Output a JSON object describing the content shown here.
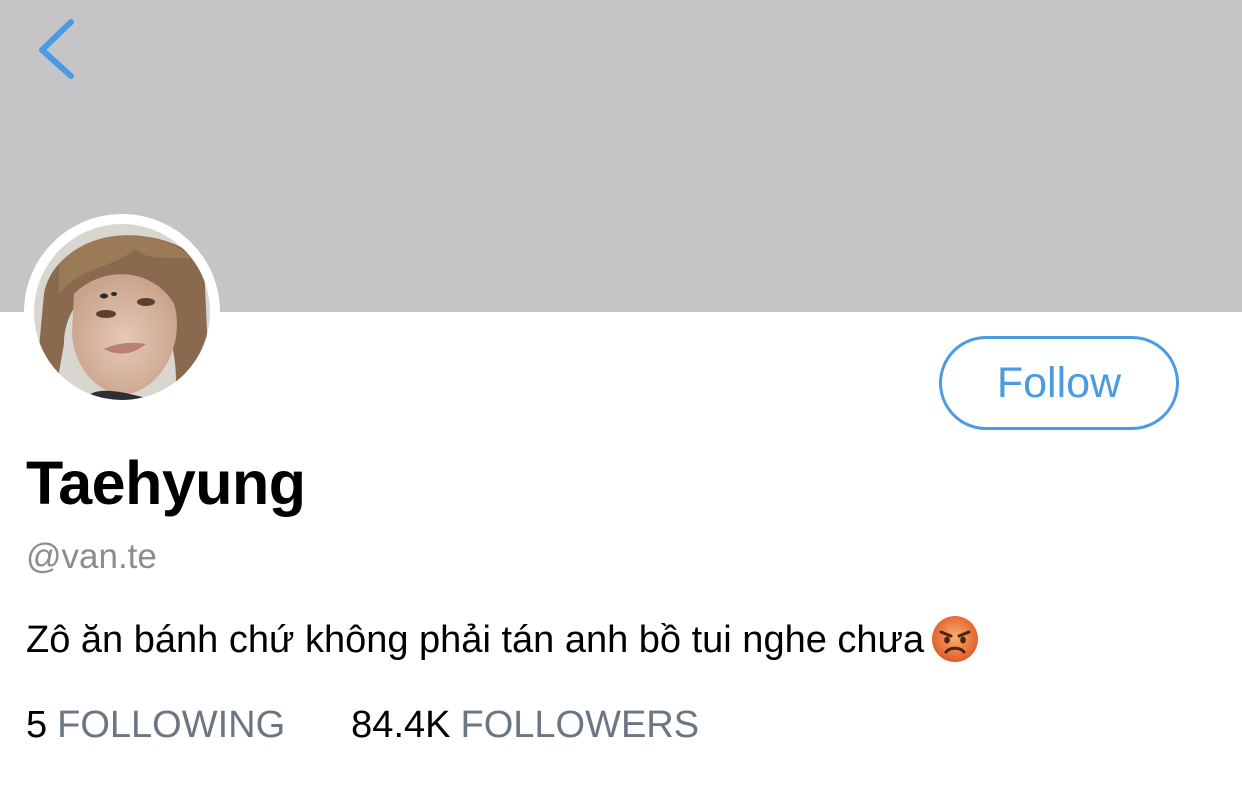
{
  "header": {
    "banner_color": "#c5c5c8",
    "back_icon": "chevron-left-icon"
  },
  "profile": {
    "display_name": "Taehyung",
    "handle": "@van.te",
    "bio_text": "Zô ăn bánh chứ không phải tán anh bồ tui nghe chưa",
    "bio_emoji": "angry-face-emoji",
    "follow_label": "Follow",
    "accent_color": "#4a9be2"
  },
  "stats": {
    "following_count": "5",
    "following_label": "FOLLOWING",
    "followers_count": "84.4K",
    "followers_label": "FOLLOWERS"
  }
}
